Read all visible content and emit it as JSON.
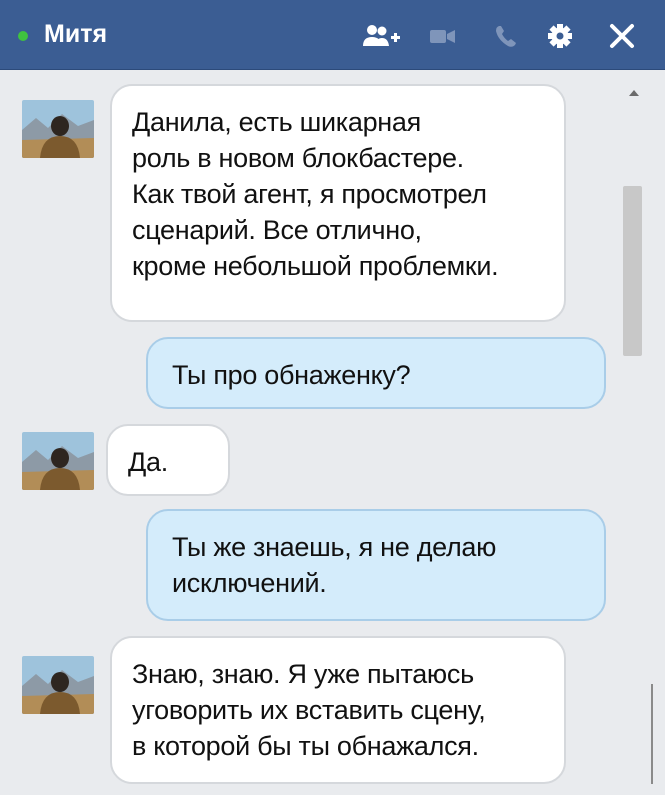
{
  "header": {
    "contact_name": "Митя",
    "status_color": "#3fc33f",
    "background_color": "#3b5d93",
    "icons": [
      "add-friend-icon",
      "video-call-icon",
      "phone-icon",
      "gear-icon",
      "close-icon"
    ]
  },
  "messages": [
    {
      "direction": "incoming",
      "lines": [
        "Данила, есть шикарная",
        "роль в новом блокбастере.",
        "Как твой агент, я просмотрел",
        "сценарий. Все отлично,",
        "кроме небольшой проблемки."
      ]
    },
    {
      "direction": "outgoing",
      "lines": [
        "Ты про обнаженку?"
      ]
    },
    {
      "direction": "incoming",
      "lines": [
        "Да."
      ]
    },
    {
      "direction": "outgoing",
      "lines": [
        "Ты же знаешь, я не делаю",
        "исключений."
      ]
    },
    {
      "direction": "incoming",
      "lines": [
        "Знаю, знаю. Я уже пытаюсь",
        "уговорить их вставить сцену,",
        "в которой бы ты обнажался."
      ]
    }
  ],
  "colors": {
    "incoming_bubble": "#ffffff",
    "outgoing_bubble": "#d4ecfb",
    "chat_background": "#e9ebee"
  }
}
